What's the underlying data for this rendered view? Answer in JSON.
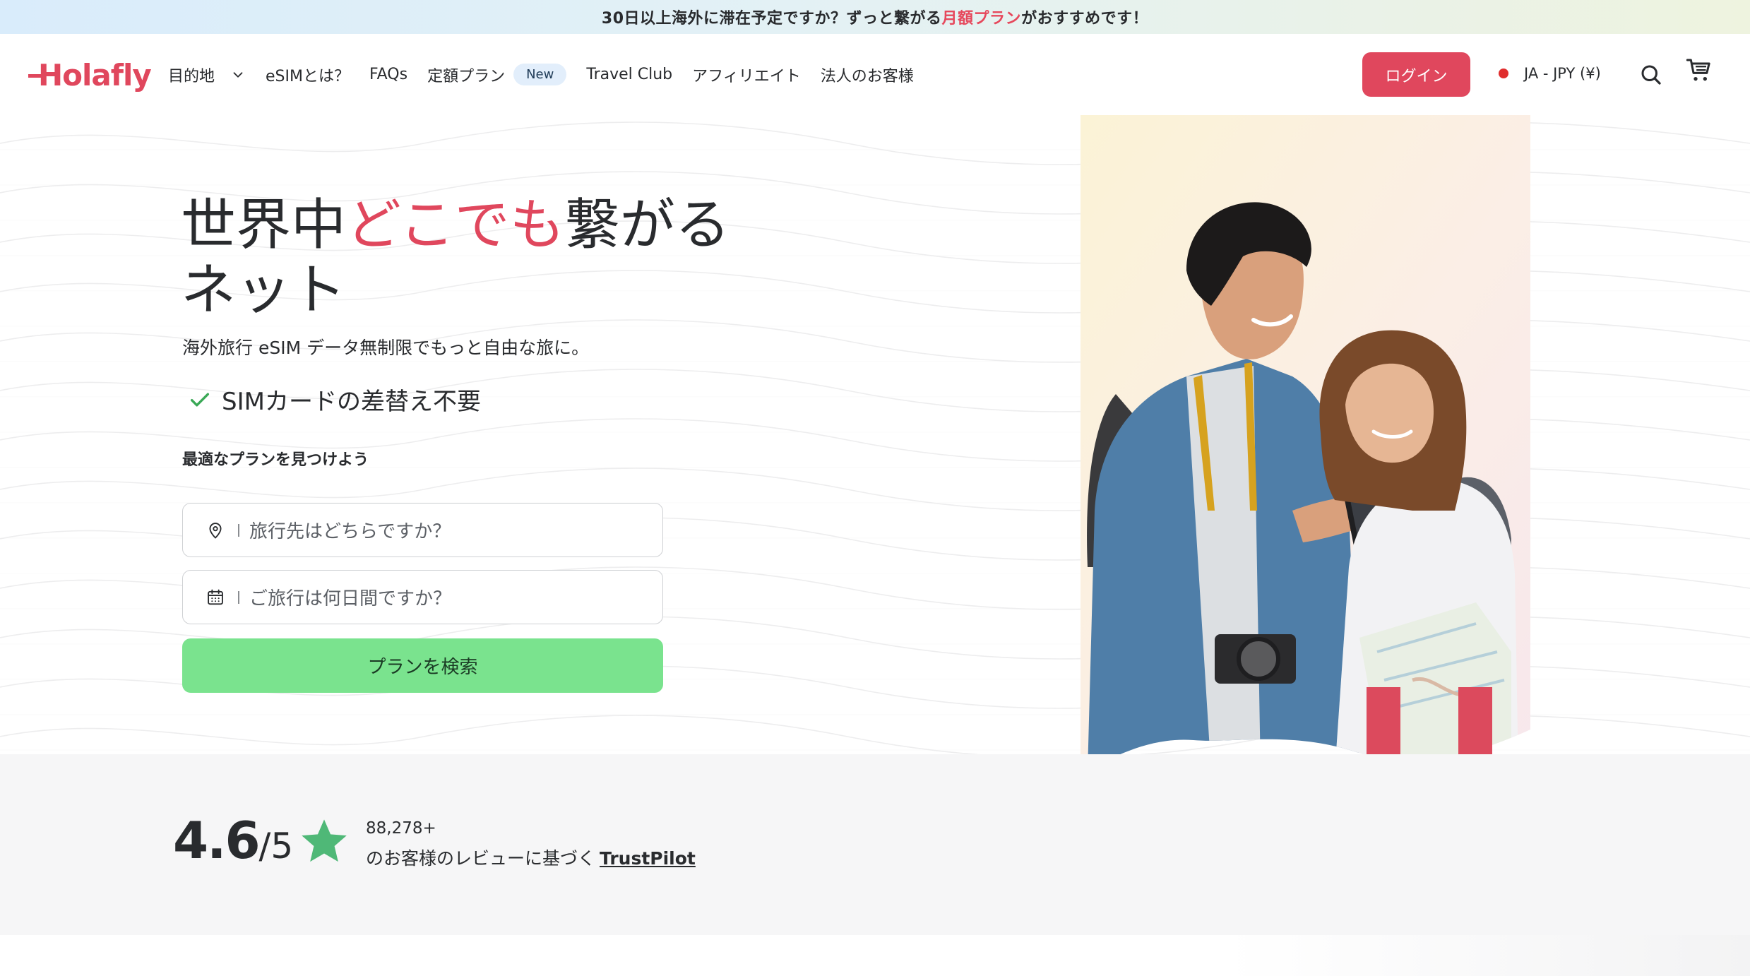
{
  "announcement": {
    "text_before": "30日以上海外に滞在予定ですか？ずっと繋がる",
    "highlight": "月額プラン",
    "text_after": "がおすすめです！"
  },
  "header": {
    "logo": "Holafly",
    "nav": {
      "destinations": "目的地",
      "what_is_esim": "eSIMとは？",
      "faqs": "FAQs",
      "monthly_plan": "定額プラン",
      "new_badge": "New",
      "travel_club": "Travel Club",
      "affiliate": "アフィリエイト",
      "business": "法人のお客様"
    },
    "login": "ログイン",
    "language": "JA - JPY (¥)"
  },
  "hero": {
    "title_part1": "世界中",
    "title_highlight": "どこでも",
    "title_part2": "繋がる",
    "title_line2": "ネット",
    "subtitle": "海外旅行 eSIM データ無制限でもっと自由な旅に。",
    "feature": "SIMカードの差替え不要",
    "find_label": "最適なプランを見つけよう",
    "destination_placeholder": "旅行先はどちらですか？",
    "days_placeholder": "ご旅行は何日間ですか？",
    "search_button": "プランを検索"
  },
  "rating": {
    "score": "4.6",
    "out_of": "/5",
    "count": "88,278+",
    "text": "のお客様のレビューに基づく",
    "source": "TrustPilot"
  },
  "colors": {
    "brand": "#e0475d",
    "cta": "#7ae38e",
    "star": "#4fb877"
  }
}
